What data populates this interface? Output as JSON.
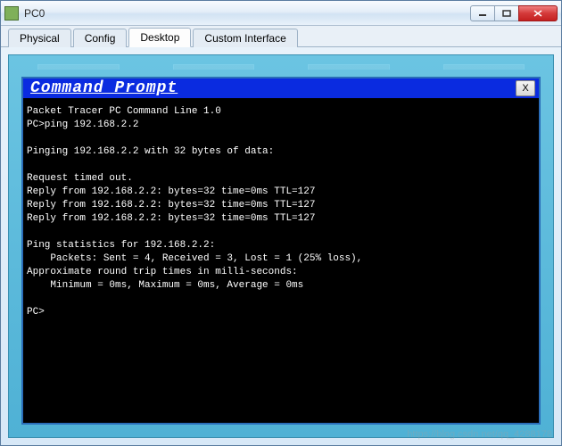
{
  "window": {
    "title": "PC0"
  },
  "tabs": [
    {
      "label": "Physical",
      "active": false
    },
    {
      "label": "Config",
      "active": false
    },
    {
      "label": "Desktop",
      "active": true
    },
    {
      "label": "Custom Interface",
      "active": false
    }
  ],
  "cmd": {
    "title": "Command Prompt",
    "close_label": "X",
    "lines": {
      "l0": "Packet Tracer PC Command Line 1.0",
      "l1": "PC>ping 192.168.2.2",
      "l2": "",
      "l3": "Pinging 192.168.2.2 with 32 bytes of data:",
      "l4": "",
      "l5": "Request timed out.",
      "l6": "Reply from 192.168.2.2: bytes=32 time=0ms TTL=127",
      "l7": "Reply from 192.168.2.2: bytes=32 time=0ms TTL=127",
      "l8": "Reply from 192.168.2.2: bytes=32 time=0ms TTL=127",
      "l9": "",
      "l10": "Ping statistics for 192.168.2.2:",
      "l11": "    Packets: Sent = 4, Received = 3, Lost = 1 (25% loss),",
      "l12": "Approximate round trip times in milli-seconds:",
      "l13": "    Minimum = 0ms, Maximum = 0ms, Average = 0ms",
      "l14": "",
      "l15": "PC>"
    }
  },
  "watermark": "https://blog.csdn.net/qq_4288178"
}
